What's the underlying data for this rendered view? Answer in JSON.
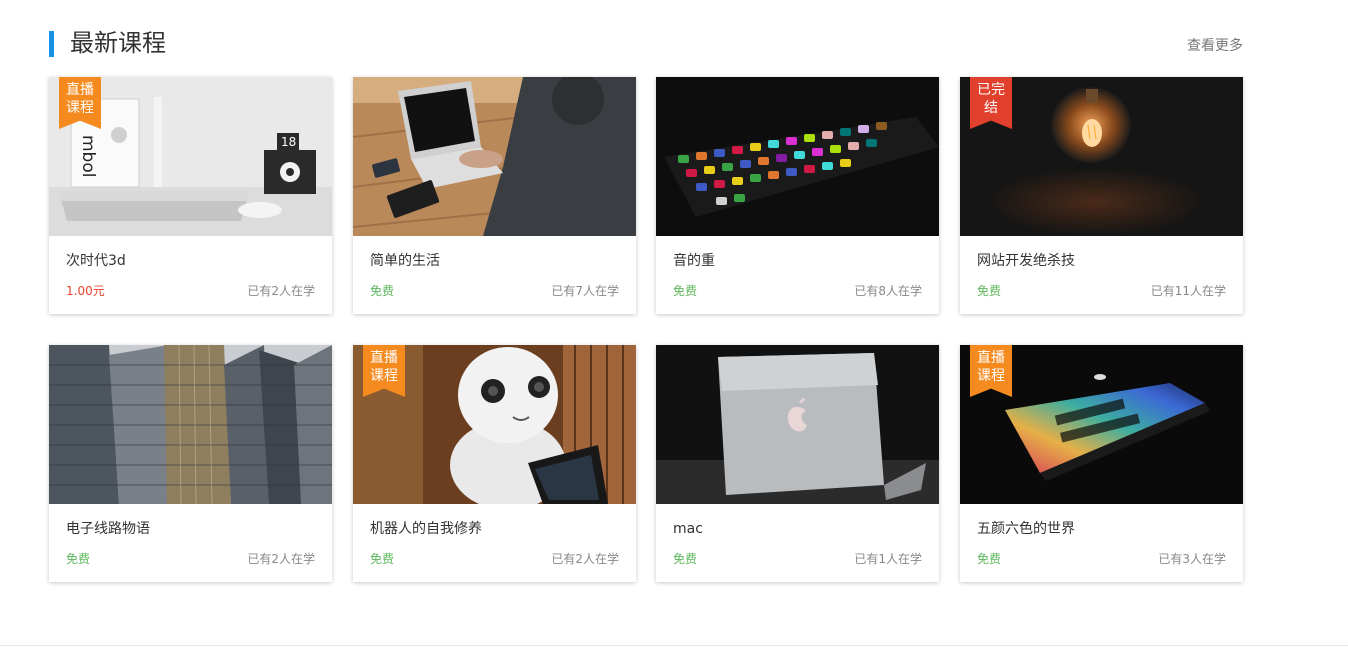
{
  "section": {
    "title": "最新课程",
    "more_label": "查看更多"
  },
  "courses": [
    {
      "title": "次时代3d",
      "price": "1.00元",
      "learners": "已有2人在学",
      "badge": [
        "直播",
        "课程"
      ]
    },
    {
      "title": "简单的生活",
      "price": "免费",
      "learners": "已有7人在学"
    },
    {
      "title": "音的重",
      "price": "免费",
      "learners": "已有8人在学"
    },
    {
      "title": "网站开发绝杀技",
      "price": "免费",
      "learners": "已有11人在学",
      "badge": [
        "已完",
        "结"
      ]
    },
    {
      "title": "电子线路物语",
      "price": "免费",
      "learners": "已有2人在学"
    },
    {
      "title": "机器人的自我修养",
      "price": "免费",
      "learners": "已有2人在学",
      "badge": [
        "直播",
        "课程"
      ]
    },
    {
      "title": "mac",
      "price": "免费",
      "learners": "已有1人在学"
    },
    {
      "title": "五颜六色的世界",
      "price": "免费",
      "learners": "已有3人在学",
      "badge": [
        "直播",
        "课程"
      ]
    }
  ],
  "colors": {
    "accent": "#1793e6",
    "free": "#5cb85c",
    "paid": "#e8422f",
    "badge_live": "#f58a1f",
    "badge_done": "#e0402c"
  }
}
